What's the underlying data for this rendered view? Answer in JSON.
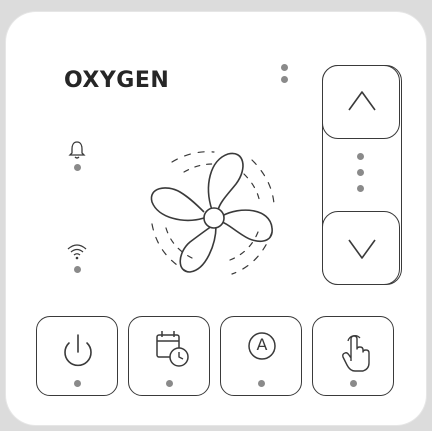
{
  "brand": {
    "name": "OXYGEN"
  },
  "icons": {
    "alarm": "bell-icon",
    "wifi": "wifi-icon",
    "fan": "fan-icon",
    "power": "power-icon",
    "schedule": "calendar-clock-icon",
    "auto": "auto-mode-icon",
    "manual": "hand-touch-icon",
    "up": "chevron-up-icon",
    "down": "chevron-down-icon"
  },
  "buttons": {
    "auto_label": "A"
  },
  "colors": {
    "panel": "#ffffff",
    "frame": "#dcdcdc",
    "outline": "#3a3a3a",
    "indicator": "#8a8a8a"
  }
}
